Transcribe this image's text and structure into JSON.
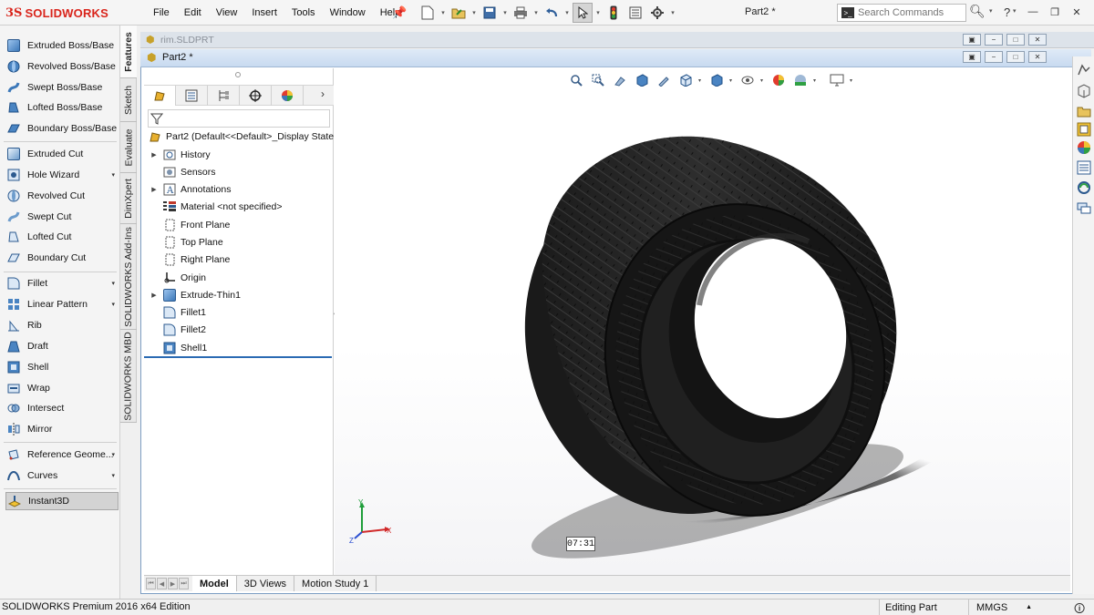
{
  "app": {
    "logo_prefix": "3S",
    "logo_name": "SOLIDWORKS"
  },
  "menu": [
    "File",
    "Edit",
    "View",
    "Insert",
    "Tools",
    "Window",
    "Help"
  ],
  "document_title": "Part2 *",
  "search": {
    "placeholder": "Search Commands"
  },
  "help_label": "?",
  "command_manager": {
    "group1": [
      "Extruded Boss/Base",
      "Revolved Boss/Base",
      "Swept Boss/Base",
      "Lofted Boss/Base",
      "Boundary Boss/Base"
    ],
    "group2": [
      "Extruded Cut",
      "Hole Wizard",
      "Revolved Cut",
      "Swept Cut",
      "Lofted Cut",
      "Boundary Cut"
    ],
    "group3": [
      "Fillet",
      "Linear Pattern",
      "Rib",
      "Draft",
      "Shell",
      "Wrap",
      "Intersect",
      "Mirror"
    ],
    "group4": [
      "Reference Geome...",
      "Curves"
    ],
    "group5": [
      "Instant3D"
    ]
  },
  "vertical_tabs": [
    "Features",
    "Sketch",
    "Evaluate",
    "DimXpert",
    "SOLIDWORKS Add-Ins",
    "SOLIDWORKS MBD"
  ],
  "background_doc": {
    "title": "rim.SLDPRT"
  },
  "active_doc": {
    "title": "Part2 *"
  },
  "feature_tree": {
    "root": "Part2  (Default<<Default>_Display State",
    "items": [
      "History",
      "Sensors",
      "Annotations",
      "Material <not specified>",
      "Front Plane",
      "Top Plane",
      "Right Plane",
      "Origin",
      "Extrude-Thin1",
      "Fillet1",
      "Fillet2",
      "Shell1"
    ]
  },
  "triad": {
    "x": "X",
    "y": "Y",
    "z": "Z"
  },
  "timer": "07:31",
  "bottom_tabs": [
    "Model",
    "3D Views",
    "Motion Study 1"
  ],
  "status": {
    "edition": "SOLIDWORKS Premium 2016 x64 Edition",
    "mode": "Editing Part",
    "units": "MMGS"
  }
}
